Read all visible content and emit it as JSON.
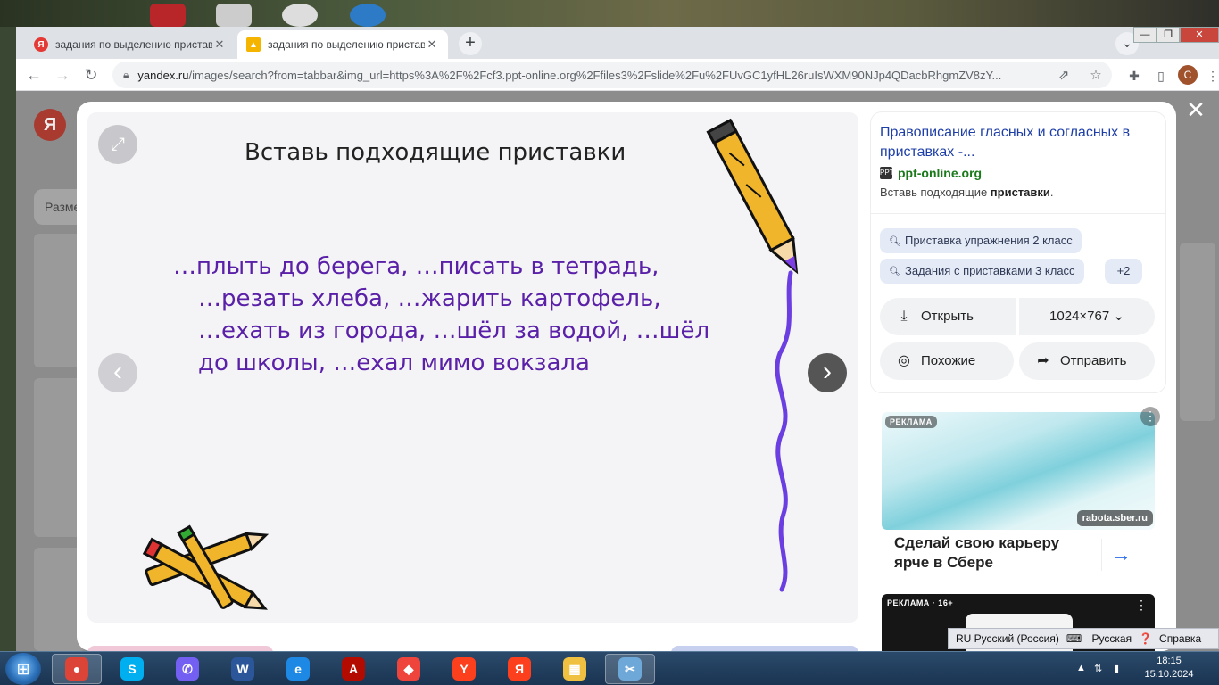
{
  "browser": {
    "tabs": [
      {
        "title": "задания по выделению пристав",
        "favicon_color": "#e53935",
        "favicon_letter": "Я"
      },
      {
        "title": "задания по выделению пристав",
        "favicon_color": "#f4b400",
        "active": true
      }
    ],
    "url_host": "yandex.ru",
    "url_rest": "/images/search?from=tabbar&img_url=https%3A%2F%2Fcf3.ppt-online.org%2Ffiles3%2Fslide%2Fu%2FUvGC1yfHL26ruIsWXM90NJp4QDacbRhgmZV8zY...",
    "profile_initial": "C"
  },
  "background_page": {
    "size_filter_label": "Разме"
  },
  "slide": {
    "title": "Вставь подходящие приставки",
    "lines": [
      "…плыть до берега, …писать в тетрадь,",
      "…резать хлеба, …жарить картофель,",
      "…ехать из города, …шёл за водой, …шёл",
      "до школы, …ехал мимо вокзала"
    ]
  },
  "info": {
    "title": "Правописание гласных и согласных в приставках -...",
    "site": "ppt-online.org",
    "site_icon": "PPT",
    "desc_prefix": "Вставь подходящие ",
    "desc_bold": "приставки",
    "desc_suffix": ".",
    "chips": [
      "Приставка упражнения 2 класс",
      "Задания с приставками 3 класс",
      "+2"
    ],
    "open_label": "Открыть",
    "size_label": "1024×767",
    "similar_label": "Похожие",
    "share_label": "Отправить"
  },
  "ads": {
    "ad1": {
      "badge": "РЕКЛАМА",
      "domain": "rabota.sber.ru",
      "headline": "Сделай свою карьеру ярче в Сбере"
    },
    "ad2": {
      "badge": "РЕКЛАМА · 16+"
    }
  },
  "langbar": {
    "lang": "RU Русский (Россия)",
    "keyboard": "Русская",
    "help": "Справка"
  },
  "taskbar": {
    "time": "18:15",
    "date": "15.10.2024",
    "items": [
      {
        "name": "chrome",
        "color": "#db4437",
        "glyph": "●"
      },
      {
        "name": "skype",
        "color": "#00aff0",
        "glyph": "S"
      },
      {
        "name": "viber",
        "color": "#7360f2",
        "glyph": "✆"
      },
      {
        "name": "word",
        "color": "#2b579a",
        "glyph": "W"
      },
      {
        "name": "ie",
        "color": "#1e88e5",
        "glyph": "e"
      },
      {
        "name": "acrobat",
        "color": "#b30b00",
        "glyph": "A"
      },
      {
        "name": "anydesk",
        "color": "#ef443b",
        "glyph": "◆"
      },
      {
        "name": "yandex-browser",
        "color": "#fc3f1d",
        "glyph": "Y"
      },
      {
        "name": "yandex",
        "color": "#fc3f1d",
        "glyph": "Я"
      },
      {
        "name": "explorer",
        "color": "#f0c040",
        "glyph": "▦"
      },
      {
        "name": "snipping-tool",
        "color": "#6ea8d8",
        "glyph": "✂"
      }
    ]
  }
}
